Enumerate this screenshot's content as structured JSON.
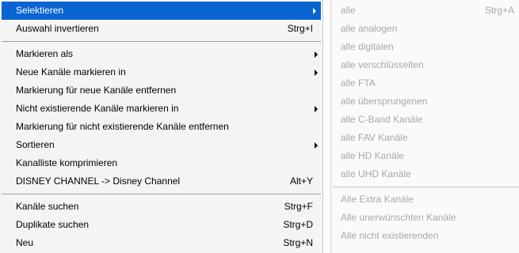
{
  "main_menu": {
    "items": [
      {
        "label": "Selektieren",
        "shortcut": "",
        "submenu": true,
        "selected": true
      },
      {
        "label": "Auswahl invertieren",
        "shortcut": "Strg+I",
        "submenu": false
      },
      {
        "label": "Markieren als",
        "shortcut": "",
        "submenu": true
      },
      {
        "label": "Neue Kanäle markieren in",
        "shortcut": "",
        "submenu": true
      },
      {
        "label": "Markierung für neue Kanäle entfernen",
        "shortcut": "",
        "submenu": false
      },
      {
        "label": "Nicht existierende Kanäle markieren in",
        "shortcut": "",
        "submenu": true
      },
      {
        "label": "Markierung für nicht existierende Kanäle entfernen",
        "shortcut": "",
        "submenu": false
      },
      {
        "label": "Sortieren",
        "shortcut": "",
        "submenu": true
      },
      {
        "label": "Kanalliste komprimieren",
        "shortcut": "",
        "submenu": false
      },
      {
        "label": "DISNEY CHANNEL -> Disney Channel",
        "shortcut": "Alt+Y",
        "submenu": false
      },
      {
        "label": "Kanäle suchen",
        "shortcut": "Strg+F",
        "submenu": false
      },
      {
        "label": "Duplikate suchen",
        "shortcut": "Strg+D",
        "submenu": false
      },
      {
        "label": "Neu",
        "shortcut": "Strg+N",
        "submenu": false
      }
    ]
  },
  "sub_menu": {
    "items": [
      {
        "label": "alle",
        "shortcut": "Strg+A"
      },
      {
        "label": "alle analogen",
        "shortcut": ""
      },
      {
        "label": "alle digitalen",
        "shortcut": ""
      },
      {
        "label": "alle verschlüsselten",
        "shortcut": ""
      },
      {
        "label": "alle FTA",
        "shortcut": ""
      },
      {
        "label": "alle übersprungenen",
        "shortcut": ""
      },
      {
        "label": "alle C-Band Kanäle",
        "shortcut": ""
      },
      {
        "label": "alle FAV Kanäle",
        "shortcut": ""
      },
      {
        "label": "alle HD Kanäle",
        "shortcut": ""
      },
      {
        "label": "alle UHD Kanäle",
        "shortcut": ""
      },
      {
        "label": "Alle Extra Kanäle",
        "shortcut": ""
      },
      {
        "label": "Alle unerwünschten Kanäle",
        "shortcut": ""
      },
      {
        "label": "Alle nicht existierenden",
        "shortcut": ""
      }
    ]
  },
  "colors": {
    "selection_bg": "#0a64d2",
    "disabled_text": "#a8a8a8"
  }
}
